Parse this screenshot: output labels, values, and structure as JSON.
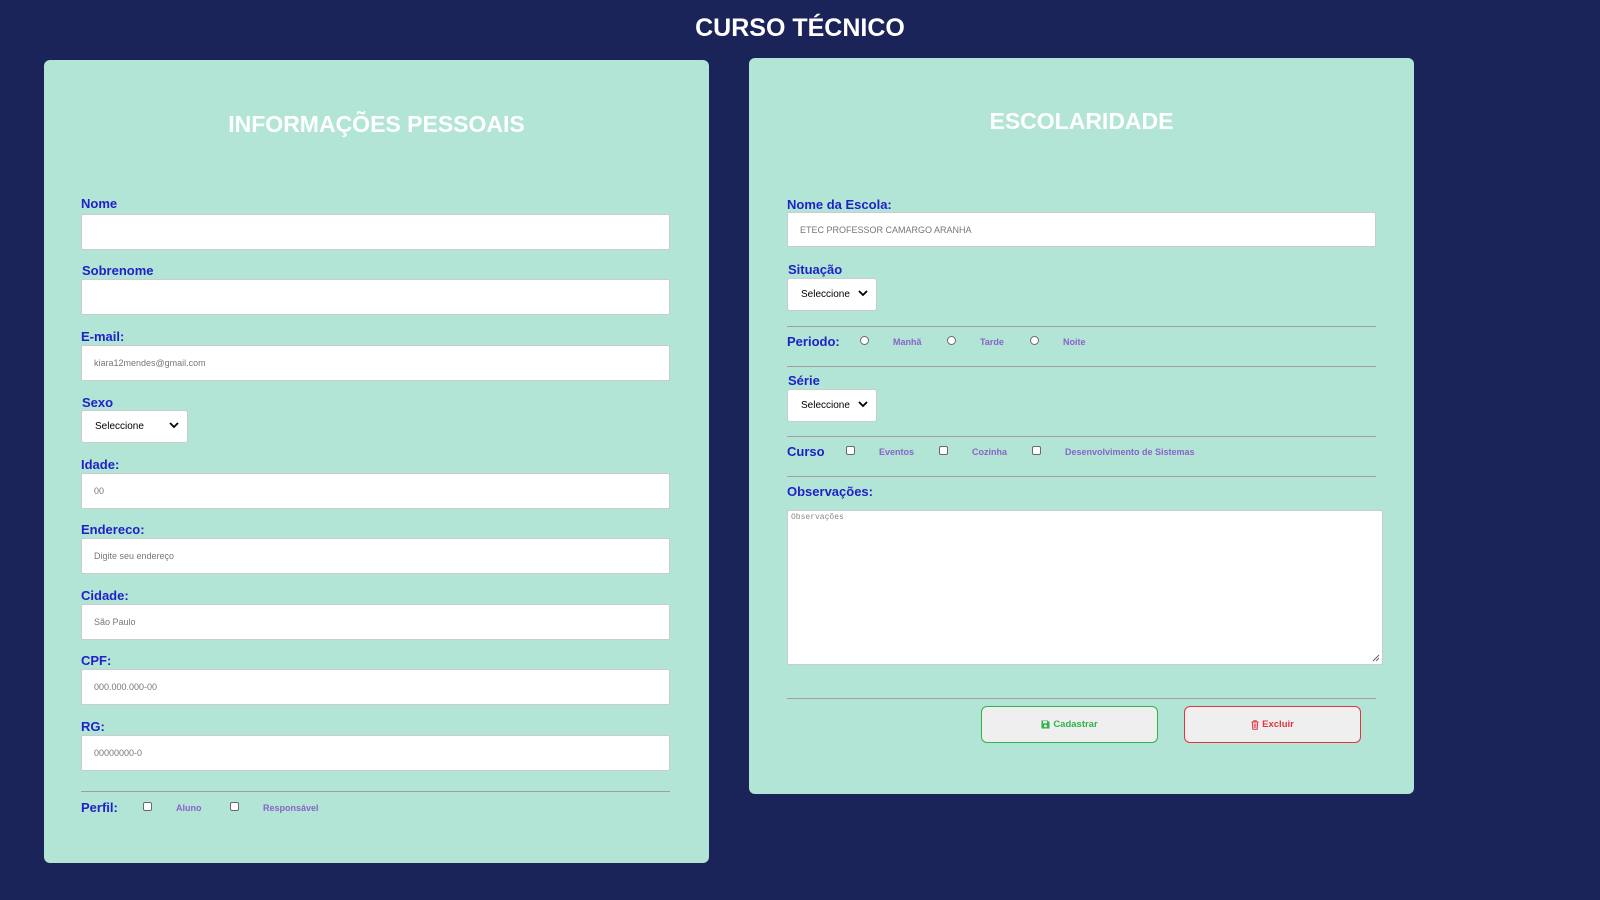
{
  "page_title": "CURSO TÉCNICO",
  "personal": {
    "title": "INFORMAÇÕES PESSOAIS",
    "nome_label": "Nome",
    "nome_value": "",
    "sobrenome_label": "Sobrenome",
    "sobrenome_value": "",
    "email_label": "E-mail:",
    "email_placeholder": "kiara12mendes@gmail.com",
    "sexo_label": "Sexo",
    "sexo_selected": "Seleccione",
    "idade_label": "Idade:",
    "idade_placeholder": "00",
    "endereco_label": "Endereco:",
    "endereco_placeholder": "Digite seu endereço",
    "cidade_label": "Cidade:",
    "cidade_placeholder": "São Paulo",
    "cpf_label": "CPF:",
    "cpf_placeholder": "000.000.000-00",
    "rg_label": "RG:",
    "rg_placeholder": "00000000-0",
    "perfil_label": "Perfil:",
    "perfil_options": [
      "Aluno",
      "Responsável"
    ]
  },
  "schooling": {
    "title": "ESCOLARIDADE",
    "escola_label": "Nome da Escola:",
    "escola_placeholder": "ETEC PROFESSOR CAMARGO ARANHA",
    "situacao_label": "Situação",
    "situacao_selected": "Seleccione",
    "periodo_label": "Periodo:",
    "periodo_options": [
      "Manhã",
      "Tarde",
      "Noite"
    ],
    "serie_label": "Série",
    "serie_selected": "Seleccione",
    "curso_label": "Curso",
    "curso_options": [
      "Eventos",
      "Cozinha",
      "Desenvolvimento de Sistemas"
    ],
    "obs_label": "Observações:",
    "obs_placeholder": "Observações"
  },
  "buttons": {
    "submit_label": "Cadastrar",
    "submit_icon": "save-icon",
    "submit_color": "#2fb34a",
    "delete_label": "Excluir",
    "delete_icon": "trash-icon",
    "delete_color": "#e0363f"
  },
  "colors": {
    "background": "#1b2459",
    "panel": "#b2e5d5",
    "label": "#2121c8",
    "option_text": "#8a63c8"
  }
}
